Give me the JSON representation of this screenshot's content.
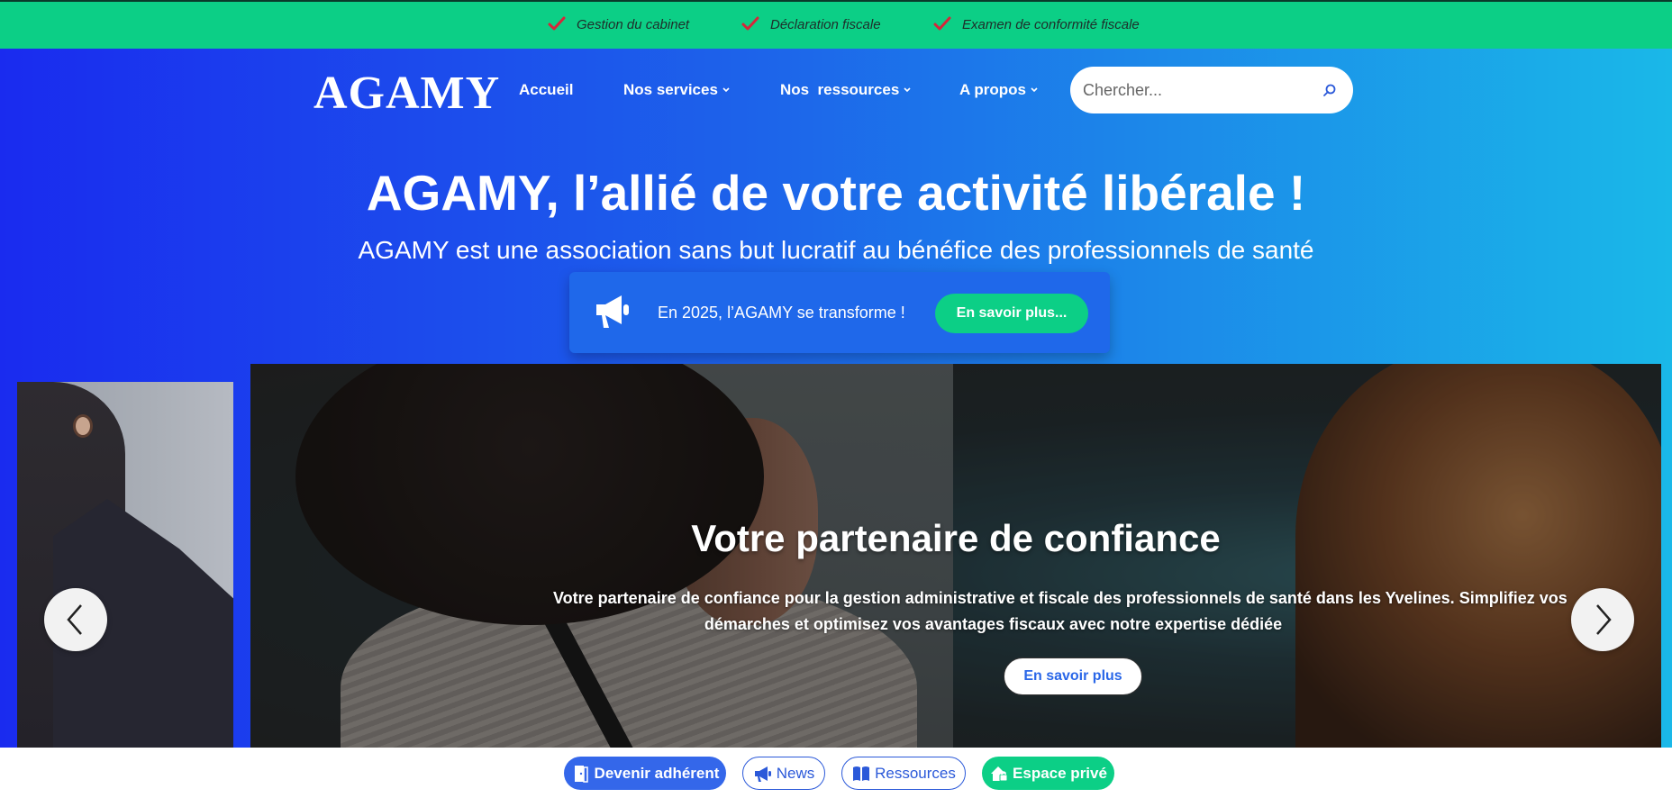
{
  "topbar": {
    "features": [
      {
        "label": "Gestion du cabinet",
        "icon": "check-icon"
      },
      {
        "label": "Déclaration fiscale",
        "icon": "check-icon"
      },
      {
        "label": "Examen de conformité fiscale",
        "icon": "check-icon"
      }
    ],
    "check_color": "#d6263a",
    "bg_color": "#0ccf86"
  },
  "header": {
    "logo": "AGAMY",
    "nav": [
      {
        "label": "Accueil",
        "has_dropdown": false
      },
      {
        "label": "Nos services",
        "has_dropdown": true
      },
      {
        "label": "Nos  ressources",
        "has_dropdown": true
      },
      {
        "label": "A propos",
        "has_dropdown": true
      }
    ],
    "search": {
      "placeholder": "Chercher...",
      "icon": "search-icon"
    }
  },
  "hero": {
    "title": "AGAMY, l’allié de votre activité libérale !",
    "subtitle": "AGAMY est une association sans but lucratif au bénéfice des professionnels de santé",
    "announcement": {
      "icon": "megaphone-icon",
      "text": "En 2025, l’AGAMY se transforme !",
      "button": "En savoir plus..."
    }
  },
  "carousel": {
    "slide_title": "Votre partenaire de confiance",
    "slide_text_line1": "Votre partenaire de confiance pour la gestion administrative et fiscale des professionnels de santé dans les Yvelines. Simplifiez vos",
    "slide_text_line2": "démarches et optimisez vos avantages fiscaux avec notre expertise dédiée",
    "slide_button": "En savoir plus",
    "prev_icon": "chevron-left-icon",
    "next_icon": "chevron-right-icon"
  },
  "bottombar": {
    "pills": [
      {
        "label": "Devenir adhérent",
        "icon": "door-icon",
        "style": "solid-blue"
      },
      {
        "label": "News",
        "icon": "megaphone-icon",
        "style": "outline"
      },
      {
        "label": "Ressources",
        "icon": "book-icon",
        "style": "outline"
      },
      {
        "label": "Espace privé",
        "icon": "house-lock-icon",
        "style": "solid-green"
      }
    ]
  },
  "colors": {
    "accent_green": "#0ccf86",
    "accent_blue": "#3467ea",
    "gradient_start": "#1a2bef",
    "gradient_end": "#1ab8e8"
  }
}
